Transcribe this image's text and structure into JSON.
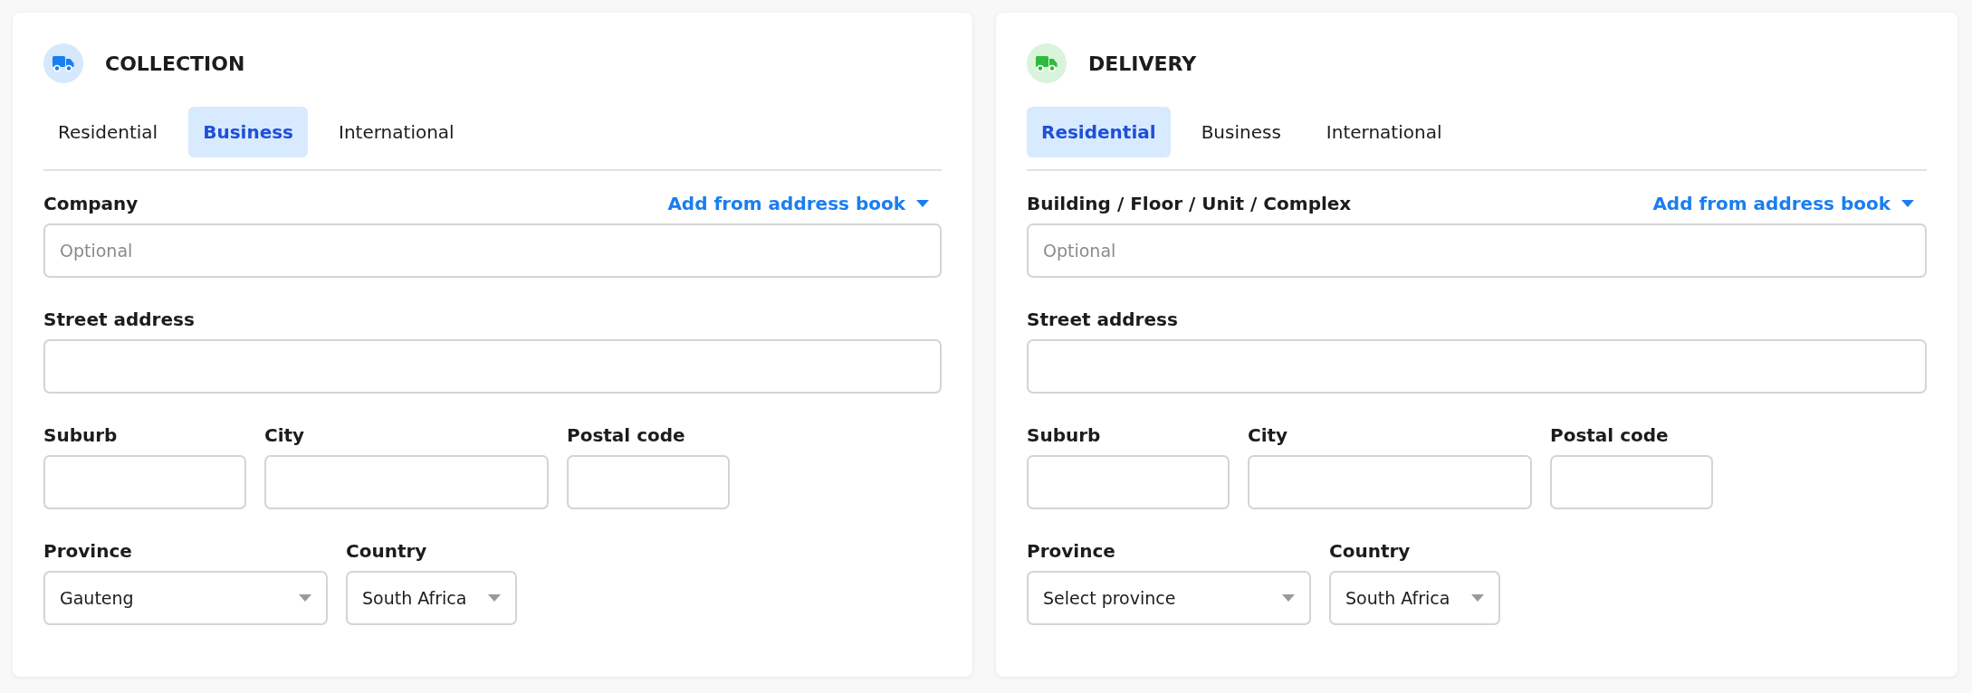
{
  "sections": [
    {
      "title": "COLLECTION",
      "color": "#1a7ef0",
      "tabs": [
        {
          "label": "Residential",
          "selected": false
        },
        {
          "label": "Business",
          "selected": true
        },
        {
          "label": "International",
          "selected": false
        }
      ],
      "address_book_link": "Add from address book",
      "rows": [
        [
          {
            "label": "Company",
            "kind": "input",
            "placeholder": "Optional"
          }
        ],
        [
          {
            "label": "Street address",
            "kind": "input"
          }
        ],
        [
          {
            "label": "Suburb",
            "kind": "input"
          },
          {
            "label": "City",
            "kind": "input"
          },
          {
            "label": "Postal code",
            "kind": "input"
          }
        ],
        [
          {
            "label": "Province",
            "kind": "select",
            "value": "Gauteng"
          },
          {
            "label": "Country",
            "kind": "select",
            "value": "South Africa"
          }
        ]
      ]
    },
    {
      "title": "DELIVERY",
      "color": "#2dbb3c",
      "tabs": [
        {
          "label": "Residential",
          "selected": true
        },
        {
          "label": "Business",
          "selected": false
        },
        {
          "label": "International",
          "selected": false
        }
      ],
      "address_book_link": "Add from address book",
      "rows": [
        [
          {
            "label": "Building / Floor / Unit / Complex",
            "kind": "input",
            "placeholder": "Optional"
          }
        ],
        [
          {
            "label": "Street address",
            "kind": "input"
          }
        ],
        [
          {
            "label": "Suburb",
            "kind": "input"
          },
          {
            "label": "City",
            "kind": "input"
          },
          {
            "label": "Postal code",
            "kind": "input"
          }
        ],
        [
          {
            "label": "Province",
            "kind": "select",
            "value": "Select province"
          },
          {
            "label": "Country",
            "kind": "select",
            "value": "South Africa"
          }
        ]
      ]
    }
  ]
}
